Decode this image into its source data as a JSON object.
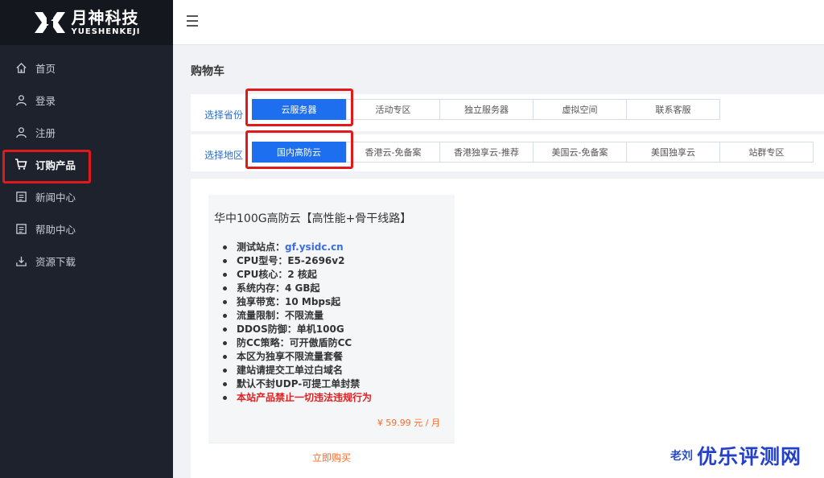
{
  "brand": {
    "name_cn": "月神科技",
    "name_en": "YUESHENKEJI"
  },
  "sidebar": {
    "items": [
      {
        "label": "首页",
        "icon": "home-icon"
      },
      {
        "label": "登录",
        "icon": "user-icon"
      },
      {
        "label": "注册",
        "icon": "user-add-icon"
      },
      {
        "label": "订购产品",
        "icon": "cart-icon",
        "active": true
      },
      {
        "label": "新闻中心",
        "icon": "news-icon"
      },
      {
        "label": "帮助中心",
        "icon": "help-icon"
      },
      {
        "label": "资源下载",
        "icon": "download-icon"
      }
    ]
  },
  "page": {
    "title": "购物车"
  },
  "province": {
    "label": "选择省份",
    "tabs": [
      "云服务器",
      "活动专区",
      "独立服务器",
      "虚拟空间",
      "联系客服"
    ],
    "selected": 0
  },
  "region": {
    "label": "选择地区",
    "tabs": [
      "国内高防云",
      "香港云-免备案",
      "香港独享云-推荐",
      "美国云-免备案",
      "美国独享云",
      "站群专区"
    ],
    "selected": 0
  },
  "product": {
    "title": "华中100G高防云【高性能+骨干线路】",
    "specs": [
      {
        "k": "测试站点：",
        "v": "gf.ysidc.cn",
        "link": true
      },
      {
        "k": "CPU型号：",
        "v": "E5-2696v2"
      },
      {
        "k": "CPU核心：",
        "v": "2 核起"
      },
      {
        "k": "系统内存：",
        "v": "4 GB起"
      },
      {
        "k": "独享带宽：",
        "v": "10 Mbps起"
      },
      {
        "k": "流量限制：",
        "v": "不限流量"
      },
      {
        "k": "DDOS防御：",
        "v": "单机100G"
      },
      {
        "k": "防CC策略：",
        "v": "可开傲盾防CC"
      },
      {
        "k": "",
        "v": "本区为独享不限流量套餐"
      },
      {
        "k": "",
        "v": "建站请提交工单过白域名"
      },
      {
        "k": "",
        "v": "默认不封UDP-可提工单封禁"
      },
      {
        "k": "",
        "v": "本站产品禁止一切违法违规行为",
        "warn": true
      }
    ],
    "price": "¥ 59.99 元 / 月",
    "buy_label": "立即购买"
  },
  "footer": {
    "partial_text": "老刘"
  },
  "watermark": "优乐评测网",
  "colors": {
    "accent": "#1e6ff0",
    "price": "#ff6a2a",
    "warning": "#e02020",
    "sidebar_bg": "#1e222d"
  }
}
